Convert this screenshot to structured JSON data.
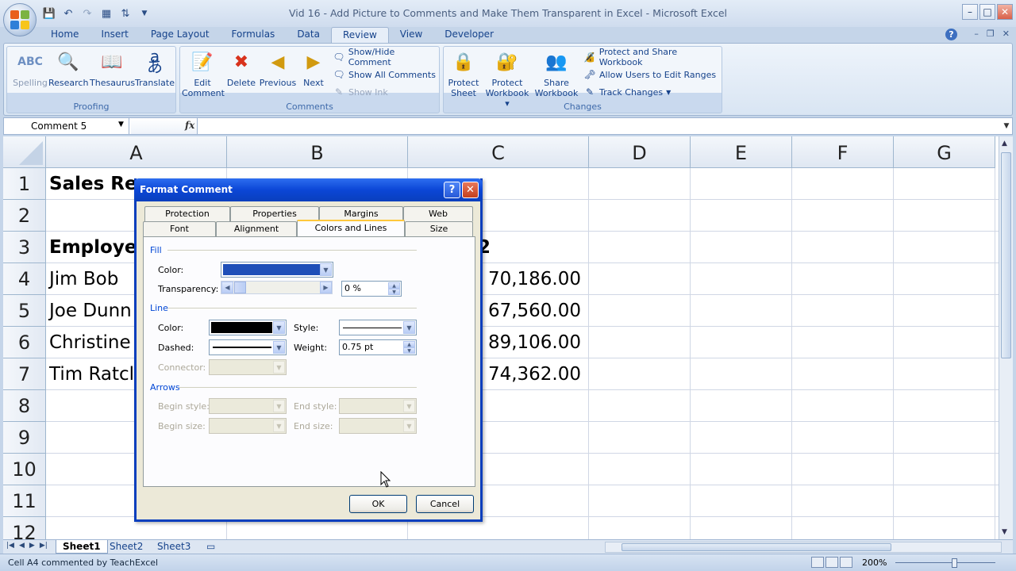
{
  "window": {
    "title": "Vid 16 - Add Picture to Comments and Make Them Transparent in Excel - Microsoft Excel",
    "controls": [
      "–",
      "□",
      "✕"
    ]
  },
  "ribbon_tabs": [
    "Home",
    "Insert",
    "Page Layout",
    "Formulas",
    "Data",
    "Review",
    "View",
    "Developer"
  ],
  "active_ribbon_tab": "Review",
  "ribbon": {
    "proofing": {
      "label": "Proofing",
      "buttons": [
        "Spelling",
        "Research",
        "Thesaurus",
        "Translate"
      ]
    },
    "comments": {
      "label": "Comments",
      "edit_line1": "Edit",
      "edit_line2": "Comment",
      "delete": "Delete",
      "previous": "Previous",
      "next": "Next",
      "show_hide": "Show/Hide Comment",
      "show_all": "Show All Comments",
      "show_ink": "Show Ink"
    },
    "changes": {
      "label": "Changes",
      "protect_sheet_1": "Protect",
      "protect_sheet_2": "Sheet",
      "protect_wb_1": "Protect",
      "protect_wb_2": "Workbook",
      "share_wb_1": "Share",
      "share_wb_2": "Workbook",
      "protect_share": "Protect and Share Workbook",
      "allow_users": "Allow Users to Edit Ranges",
      "track_changes": "Track Changes"
    }
  },
  "formula_bar": {
    "name_box": "Comment 5",
    "fx": "fx",
    "content": ""
  },
  "columns": [
    "A",
    "B",
    "C",
    "D",
    "E",
    "F",
    "G"
  ],
  "rows": [
    "1",
    "2",
    "3",
    "4",
    "5",
    "6",
    "7",
    "8",
    "9",
    "10",
    "11",
    "12"
  ],
  "cells": {
    "a1": "Sales Rep",
    "a3": "Employe",
    "c3": "2",
    "a4": "Jim Bob",
    "a5": "Joe Dunn",
    "a6": "Christine",
    "a7": "Tim Ratcl",
    "c4": "70,186.00",
    "c5": "67,560.00",
    "c6": "89,106.00",
    "c7": "74,362.00"
  },
  "sheets": [
    "Sheet1",
    "Sheet2",
    "Sheet3"
  ],
  "active_sheet": "Sheet1",
  "status": {
    "text": "Cell A4 commented by TeachExcel",
    "zoom": "200%"
  },
  "dialog": {
    "title": "Format Comment",
    "tabs_row1": [
      "Protection",
      "Properties",
      "Margins",
      "Web"
    ],
    "tabs_row2": [
      "Font",
      "Alignment",
      "Colors and Lines",
      "Size"
    ],
    "active_tab": "Colors and Lines",
    "fill": {
      "section": "Fill",
      "color_label": "Color:",
      "color_value": "#1f4fb8",
      "transparency_label": "Transparency:",
      "transparency_value": "0 %",
      "transparency_level": 0
    },
    "line": {
      "section": "Line",
      "color_label": "Color:",
      "color_value": "#000000",
      "style_label": "Style:",
      "dashed_label": "Dashed:",
      "weight_label": "Weight:",
      "weight_value": "0.75 pt",
      "connector_label": "Connector:"
    },
    "arrows": {
      "section": "Arrows",
      "begin_style": "Begin style:",
      "end_style": "End style:",
      "begin_size": "Begin size:",
      "end_size": "End size:"
    },
    "ok": "OK",
    "cancel": "Cancel"
  }
}
